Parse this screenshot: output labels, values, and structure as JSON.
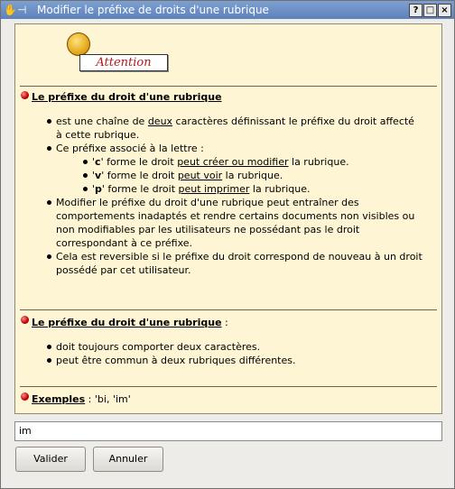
{
  "window": {
    "title": "Modifier le préfixe de droits d'une rubrique",
    "buttons": {
      "help": "?",
      "maximize": "□",
      "close": "×"
    }
  },
  "attention_label": "Attention",
  "section1": {
    "heading": "Le préfixe du droit d'une rubrique",
    "l1a": "est une chaîne de ",
    "l1b": "deux",
    "l1c": "  caractères définissant le préfixe du droit affecté",
    "l1d": "à cette rubrique.",
    "l2": "Ce préfixe associé à la lettre :",
    "c_pre": "'",
    "c_letter": "c",
    "c_post": "' forme le droit ",
    "c_link": "peut créer ou modifier",
    "c_end": " la rubrique.",
    "v_pre": "'",
    "v_letter": "v",
    "v_post": "' forme le droit ",
    "v_link": "peut voir",
    "v_end": " la rubrique.",
    "p_pre": "'",
    "p_letter": "p",
    "p_post": "' forme le droit ",
    "p_link": "peut imprimer",
    "p_end": " la rubrique.",
    "l3a": "Modifier le préfixe du droit d'une rubrique peut entraîner des",
    "l3b": "comportements inadaptés et rendre certains documents non visibles ou",
    "l3c": "non modifiables par les utilisateurs ne possédant pas le droit",
    "l3d": "correspondant à ce préfixe.",
    "l4a": "Cela est reversible si le préfixe du droit correspond de nouveau à un droit",
    "l4b": "possédé par cet utilisateur."
  },
  "section2": {
    "heading": "Le préfixe du droit d'une rubrique",
    "colon": " :",
    "l1": "doit toujours comporter deux caractères.",
    "l2": "peut être commun à deux rubriques différentes."
  },
  "section3": {
    "heading": "Exemples",
    "text": " : 'bi, 'im'"
  },
  "input": {
    "value": "im"
  },
  "buttons": {
    "ok": "Valider",
    "cancel": "Annuler"
  }
}
